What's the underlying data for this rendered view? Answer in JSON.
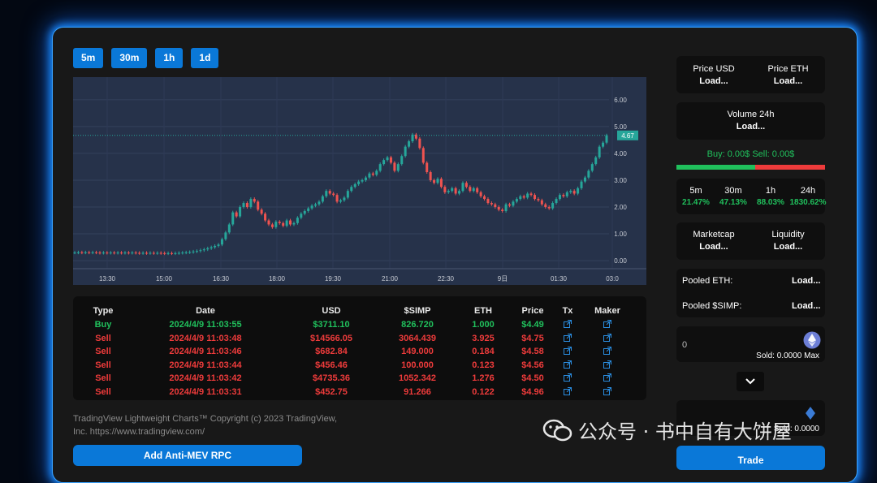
{
  "timeframes": [
    "5m",
    "30m",
    "1h",
    "1d"
  ],
  "chart_data": {
    "type": "candlestick",
    "x_ticks": [
      "13:30",
      "15:00",
      "16:30",
      "18:00",
      "19:30",
      "21:00",
      "22:30",
      "9日",
      "01:30",
      "03:0"
    ],
    "y_ticks": [
      "6.00",
      "5.00",
      "4.00",
      "3.00",
      "2.00",
      "1.00",
      "0.00"
    ],
    "ylim": [
      -0.3,
      6.6
    ],
    "last_price": "4.67",
    "grid": true,
    "series_close": [
      0.3,
      0.31,
      0.3,
      0.31,
      0.3,
      0.31,
      0.3,
      0.29,
      0.3,
      0.29,
      0.3,
      0.29,
      0.3,
      0.29,
      0.3,
      0.29,
      0.3,
      0.29,
      0.28,
      0.29,
      0.28,
      0.29,
      0.28,
      0.29,
      0.28,
      0.27,
      0.28,
      0.27,
      0.28,
      0.29,
      0.3,
      0.31,
      0.32,
      0.34,
      0.36,
      0.39,
      0.42,
      0.46,
      0.5,
      0.55,
      0.6,
      0.8,
      1.05,
      1.35,
      1.8,
      1.65,
      2.0,
      2.15,
      2.0,
      2.3,
      2.2,
      1.9,
      1.75,
      1.5,
      1.35,
      1.25,
      1.45,
      1.4,
      1.3,
      1.5,
      1.35,
      1.4,
      1.6,
      1.75,
      1.85,
      1.95,
      2.05,
      2.1,
      2.2,
      2.4,
      2.6,
      2.5,
      2.45,
      2.2,
      2.25,
      2.35,
      2.6,
      2.75,
      2.85,
      2.95,
      3.0,
      3.1,
      3.25,
      3.2,
      3.35,
      3.6,
      3.75,
      3.85,
      3.65,
      3.35,
      3.6,
      3.9,
      4.25,
      4.45,
      4.7,
      4.55,
      4.2,
      3.65,
      3.3,
      3.0,
      2.9,
      3.05,
      2.75,
      2.55,
      2.6,
      2.7,
      2.5,
      2.6,
      2.9,
      2.75,
      2.6,
      2.7,
      2.55,
      2.4,
      2.3,
      2.15,
      2.1,
      2.0,
      1.9,
      1.85,
      2.1,
      2.05,
      2.2,
      2.3,
      2.4,
      2.35,
      2.5,
      2.45,
      2.3,
      2.25,
      2.1,
      2.0,
      1.95,
      2.15,
      2.3,
      2.45,
      2.4,
      2.55,
      2.6,
      2.5,
      2.7,
      2.95,
      3.1,
      3.35,
      3.6,
      3.85,
      4.25,
      4.4,
      4.67
    ]
  },
  "trades": {
    "headers": [
      "Type",
      "Date",
      "USD",
      "$SIMP",
      "ETH",
      "Price",
      "Tx",
      "Maker"
    ],
    "rows": [
      {
        "type": "Buy",
        "date": "2024/4/9 11:03:55",
        "usd": "$3711.10",
        "simp": "826.720",
        "eth": "1.000",
        "price": "$4.49",
        "side": "buy"
      },
      {
        "type": "Sell",
        "date": "2024/4/9 11:03:48",
        "usd": "$14566.05",
        "simp": "3064.439",
        "eth": "3.925",
        "price": "$4.75",
        "side": "sell"
      },
      {
        "type": "Sell",
        "date": "2024/4/9 11:03:46",
        "usd": "$682.84",
        "simp": "149.000",
        "eth": "0.184",
        "price": "$4.58",
        "side": "sell"
      },
      {
        "type": "Sell",
        "date": "2024/4/9 11:03:44",
        "usd": "$456.46",
        "simp": "100.000",
        "eth": "0.123",
        "price": "$4.56",
        "side": "sell"
      },
      {
        "type": "Sell",
        "date": "2024/4/9 11:03:42",
        "usd": "$4735.36",
        "simp": "1052.342",
        "eth": "1.276",
        "price": "$4.50",
        "side": "sell"
      },
      {
        "type": "Sell",
        "date": "2024/4/9 11:03:31",
        "usd": "$452.75",
        "simp": "91.266",
        "eth": "0.122",
        "price": "$4.96",
        "side": "sell"
      }
    ]
  },
  "attribution": "TradingView Lightweight Charts™ Copyright (c) 2023 TradingView, Inc. https://www.tradingview.com/",
  "mev_button": "Add Anti-MEV RPC",
  "stats": {
    "price_usd_label": "Price USD",
    "price_usd_value": "Load...",
    "price_eth_label": "Price ETH",
    "price_eth_value": "Load...",
    "volume_label": "Volume 24h",
    "volume_value": "Load...",
    "buy_sell": "Buy: 0.00$ Sell: 0.00$",
    "buy_fraction": 0.53,
    "changes": [
      {
        "label": "5m",
        "value": "21.47%"
      },
      {
        "label": "30m",
        "value": "47.13%"
      },
      {
        "label": "1h",
        "value": "88.03%"
      },
      {
        "label": "24h",
        "value": "1830.62%"
      }
    ],
    "marketcap_label": "Marketcap",
    "marketcap_value": "Load...",
    "liquidity_label": "Liquidity",
    "liquidity_value": "Load...",
    "pooled_eth_label": "Pooled ETH:",
    "pooled_eth_value": "Load...",
    "pooled_simp_label": "Pooled $SIMP:",
    "pooled_simp_value": "Load..."
  },
  "swap": {
    "from_amount": "0",
    "sold_label": "Sold: 0.0000 Max",
    "sold_label_2": "Sold: 0.0000",
    "trade_label": "Trade"
  },
  "watermark": "公众号 · 书中自有大饼屋",
  "colors": {
    "accent": "#0a78d8",
    "up": "#26a69a",
    "down": "#ef5350",
    "buy": "#20c05c",
    "sell": "#ee3b3b"
  }
}
